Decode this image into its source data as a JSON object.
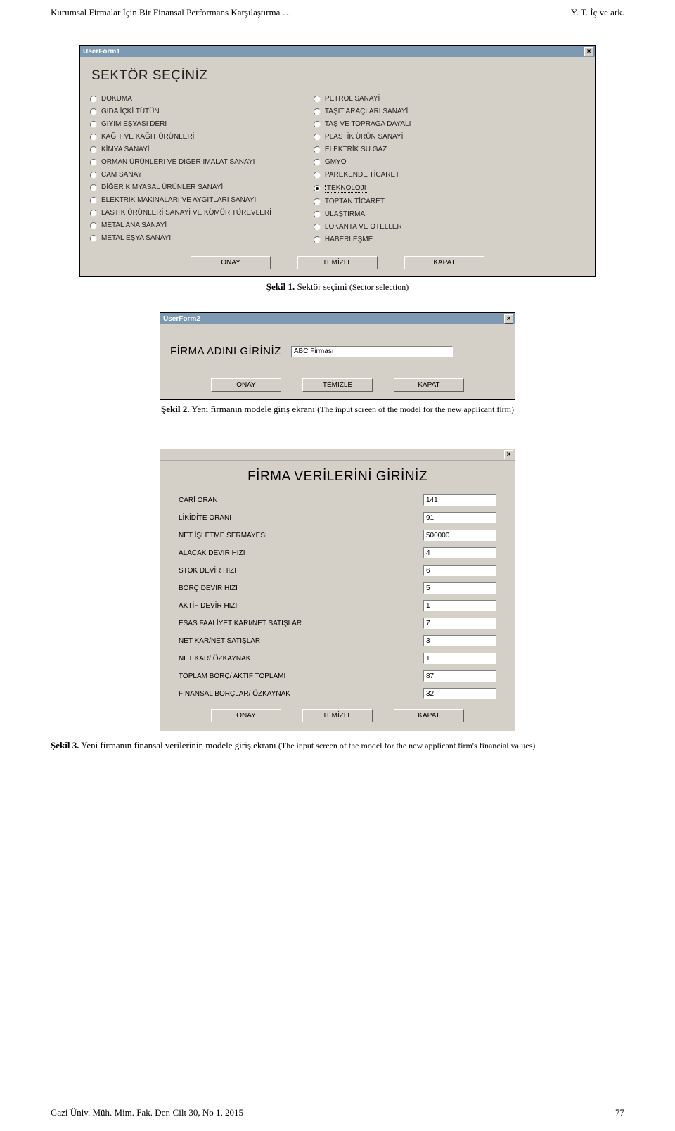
{
  "header": {
    "left": "Kurumsal Firmalar İçin Bir Finansal Performans Karşılaştırma …",
    "right": "Y. T. İç ve ark."
  },
  "footer": {
    "left": "Gazi Üniv. Müh. Mim. Fak. Der. Cilt 30, No 1, 2015",
    "right": "77"
  },
  "caption1": {
    "label": "Şekil 1.",
    "tr": "Sektör seçimi",
    "en": "(Sector selection)"
  },
  "caption2": {
    "label": "Şekil 2.",
    "tr": " Yeni firmanın modele giriş ekranı ",
    "en": "(The input screen of the model for the new applicant firm)"
  },
  "caption3": {
    "label": "Şekil 3.",
    "tr": " Yeni firmanın finansal verilerinin modele giriş ekranı ",
    "en": "(The input screen of the model for the new applicant firm's financial values)"
  },
  "form1": {
    "title": "UserForm1",
    "heading": "SEKTÖR SEÇİNİZ",
    "left": [
      "DOKUMA",
      "GIDA İÇKİ TÜTÜN",
      "GİYİM EŞYASI DERİ",
      "KAĞIT VE KAĞIT ÜRÜNLERİ",
      "KİMYA SANAYİ",
      "ORMAN ÜRÜNLERİ VE DİĞER İMALAT SANAYİ",
      "CAM SANAYİ",
      "DİĞER KİMYASAL ÜRÜNLER SANAYİ",
      "ELEKTRİK MAKİNALARI VE AYGITLARI SANAYİ",
      "LASTİK ÜRÜNLERİ SANAYİ VE KÖMÜR TÜREVLERİ",
      "METAL ANA SANAYİ",
      "METAL EŞYA SANAYİ"
    ],
    "right": [
      "PETROL SANAYİ",
      "TAŞIT ARAÇLARI SANAYİ",
      "TAŞ VE TOPRAĞA DAYALI",
      "PLASTİK ÜRÜN SANAYİ",
      "ELEKTRİK SU GAZ",
      "GMYO",
      "PAREKENDE TİCARET",
      "TEKNOLOJİ",
      "TOPTAN TİCARET",
      "ULAŞTIRMA",
      "LOKANTA VE OTELLER",
      "HABERLEŞME"
    ],
    "selected": "TEKNOLOJİ",
    "buttons": {
      "ok": "ONAY",
      "clear": "TEMİZLE",
      "close": "KAPAT"
    }
  },
  "form2": {
    "title": "UserForm2",
    "label": "FİRMA ADINI GİRİNİZ",
    "value": "ABC Firması",
    "buttons": {
      "ok": "ONAY",
      "clear": "TEMİZLE",
      "close": "KAPAT"
    }
  },
  "form3": {
    "heading": "FİRMA VERİLERİNİ GİRİNİZ",
    "fields": [
      {
        "label": "CARİ ORAN",
        "value": "141"
      },
      {
        "label": "LİKİDİTE ORANI",
        "value": "91"
      },
      {
        "label": "NET İŞLETME SERMAYESİ",
        "value": "500000"
      },
      {
        "label": "ALACAK DEVİR HIZI",
        "value": "4"
      },
      {
        "label": "STOK DEVİR HIZI",
        "value": "6"
      },
      {
        "label": "BORÇ DEVİR HIZI",
        "value": "5"
      },
      {
        "label": "AKTİF DEVİR HIZI",
        "value": "1"
      },
      {
        "label": "ESAS FAALİYET KARI/NET SATIŞLAR",
        "value": "7"
      },
      {
        "label": "NET KAR/NET SATIŞLAR",
        "value": "3"
      },
      {
        "label": "NET KAR/ ÖZKAYNAK",
        "value": "1"
      },
      {
        "label": "TOPLAM BORÇ/ AKTİF TOPLAMI",
        "value": "87"
      },
      {
        "label": "FİNANSAL BORÇLAR/ ÖZKAYNAK",
        "value": "32"
      }
    ],
    "buttons": {
      "ok": "ONAY",
      "clear": "TEMİZLE",
      "close": "KAPAT"
    }
  }
}
